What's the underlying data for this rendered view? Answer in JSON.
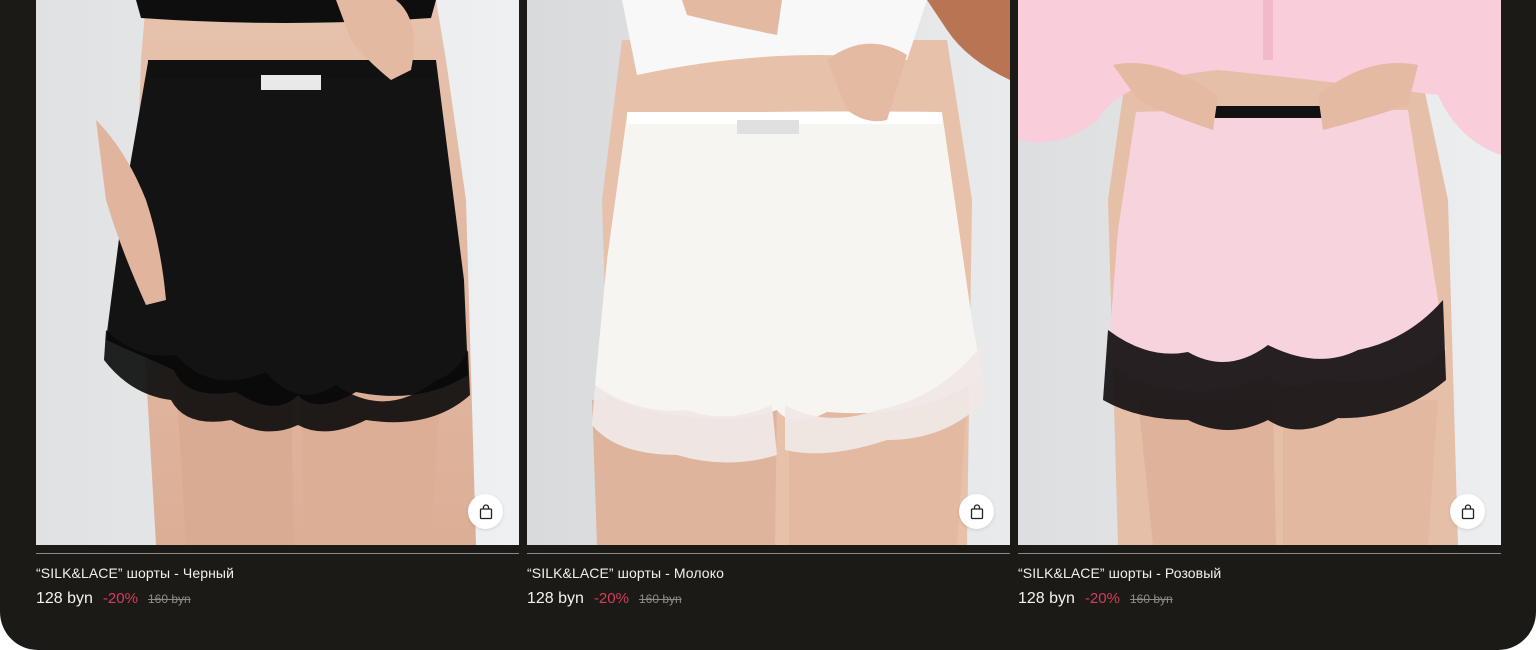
{
  "products": [
    {
      "title": "“SILK&LACE” шорты - Черный",
      "price": "128 byn",
      "discount": "-20%",
      "old_price": "160 byn",
      "image_alt": "black silk shorts with lace hem",
      "shorts_color": "#131313",
      "lace_color": "#0a0a0a",
      "top_color": "#0e0e0e",
      "waistband_color": "#111111"
    },
    {
      "title": "“SILK&LACE” шорты - Молоко",
      "price": "128 byn",
      "discount": "-20%",
      "old_price": "160 byn",
      "image_alt": "milk white silk shorts with lace hem",
      "shorts_color": "#f7f5f1",
      "lace_color": "#efe8e6",
      "top_color": "#fafafa",
      "waistband_color": "#ffffff"
    },
    {
      "title": "“SILK&LACE” шорты - Розовый",
      "price": "128 byn",
      "discount": "-20%",
      "old_price": "160 byn",
      "image_alt": "pink silk shorts with black lace hem",
      "shorts_color": "#f7d4dd",
      "lace_color": "#141012",
      "top_color": "#f9cdd9",
      "waistband_color": "#111111"
    }
  ],
  "icons": {
    "cart": "shopping-bag-icon"
  },
  "colors": {
    "background": "#1b1a17",
    "discount": "#d63c5c",
    "old_price": "#8d8c88",
    "divider": "#8a8985"
  }
}
